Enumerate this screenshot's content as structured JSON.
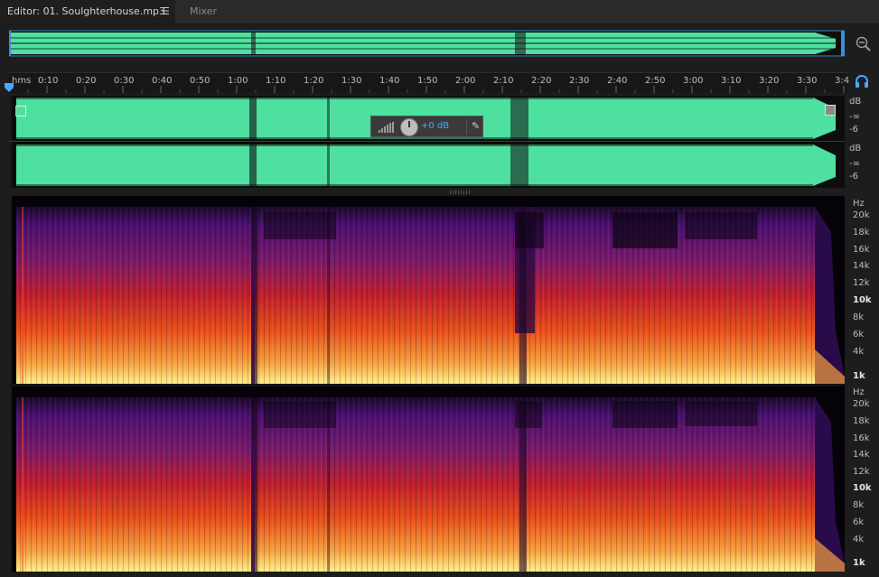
{
  "tabs": {
    "editor_label": "Editor: 01. Soulghterhouse.mp3",
    "menu_glyph": "☰",
    "mixer_label": "Mixer"
  },
  "timeline": {
    "unit_label": "hms",
    "ticks": [
      "0:10",
      "0:20",
      "0:30",
      "0:40",
      "0:50",
      "1:00",
      "1:10",
      "1:20",
      "1:30",
      "1:40",
      "1:50",
      "2:00",
      "2:10",
      "2:20",
      "2:30",
      "2:40",
      "2:50",
      "3:00",
      "3:10",
      "3:20",
      "3:30",
      "3:4"
    ]
  },
  "waveform": {
    "color": "#4ee0a0",
    "channel_1_db": {
      "unit": "dB",
      "inf": "-∞",
      "minus6": "-6"
    },
    "channel_2_db": {
      "unit": "dB",
      "inf": "-∞",
      "minus6": "-6"
    }
  },
  "hud": {
    "gain_text": "+0 dB",
    "pin_glyph": "✎"
  },
  "spectral": {
    "unit": "Hz",
    "labels": [
      "20k",
      "18k",
      "16k",
      "14k",
      "12k",
      "10k",
      "8k",
      "6k",
      "4k",
      "1k"
    ],
    "bold_labels": [
      "10k",
      "1k"
    ]
  },
  "icons": {
    "zoom": "zoom-out-icon",
    "headphones": "headphones-icon",
    "playhead": "playhead-marker-icon",
    "level_meter": "level-meter-icon",
    "gain_knob": "gain-knob-icon",
    "pin": "pin-icon"
  },
  "colors": {
    "accent": "#46a9ff",
    "background": "#1d1d1d"
  }
}
